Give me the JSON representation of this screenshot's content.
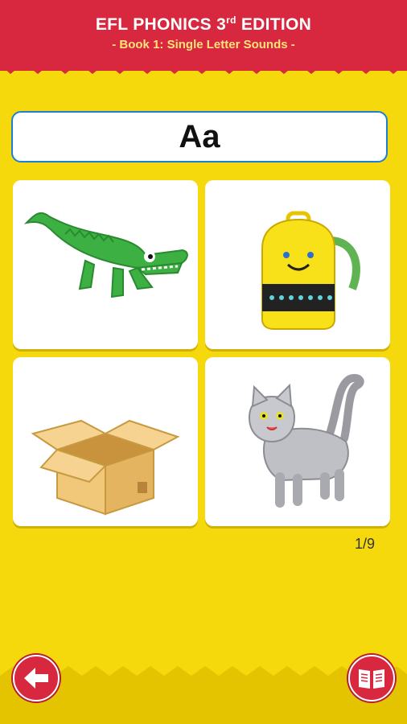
{
  "header": {
    "title_main": "EFL PHONICS 3",
    "title_sup": "rd",
    "title_end": " EDITION",
    "subtitle": "- Book 1: Single Letter Sounds -"
  },
  "letter": "Aa",
  "cards": [
    {
      "icon": "alligator-icon"
    },
    {
      "icon": "backpack-icon"
    },
    {
      "icon": "box-icon"
    },
    {
      "icon": "cat-icon"
    }
  ],
  "page_counter": "1/9",
  "nav": {
    "back_icon": "arrow-left-icon",
    "book_icon": "book-icon"
  },
  "colors": {
    "background": "#f6d90c",
    "header": "#d8283f",
    "accent_border": "#1b7fd6"
  }
}
